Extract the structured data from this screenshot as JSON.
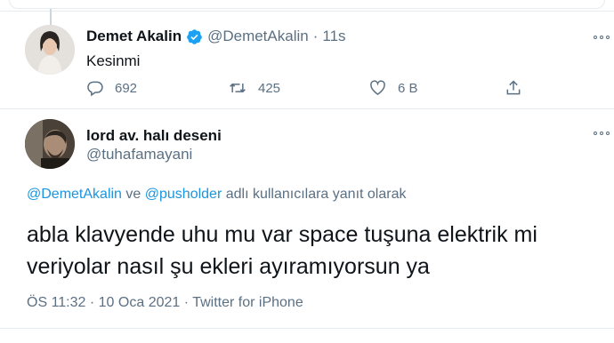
{
  "original_tweet": {
    "author_name": "Demet Akalin",
    "handle": "@DemetAkalin",
    "separator": "·",
    "time": "11s",
    "text": "Kesinmi",
    "verified": true,
    "actions": {
      "reply_count": "692",
      "retweet_count": "425",
      "like_count": "6 B"
    }
  },
  "reply_tweet": {
    "author_name": "lord av. halı deseni",
    "handle": "@tuhafamayani",
    "replying_to": {
      "mention1": "@DemetAkalin",
      "conjunction": " ve ",
      "mention2": "@pusholder",
      "suffix": " adlı kullanıcılara yanıt olarak"
    },
    "text_line1": "abla klavyende uhu mu var space tuşuna elektrik mi",
    "text_line2": "veriyolar nasıl şu ekleri ayıramıyorsun ya",
    "time": "ÖS 11:32",
    "separator": "·",
    "date": "10 Oca 2021",
    "source": "Twitter for iPhone"
  },
  "colors": {
    "accent": "#1b95e0",
    "muted": "#5b7083",
    "text": "#0f1419",
    "verified_badge": "#1da1f2"
  }
}
